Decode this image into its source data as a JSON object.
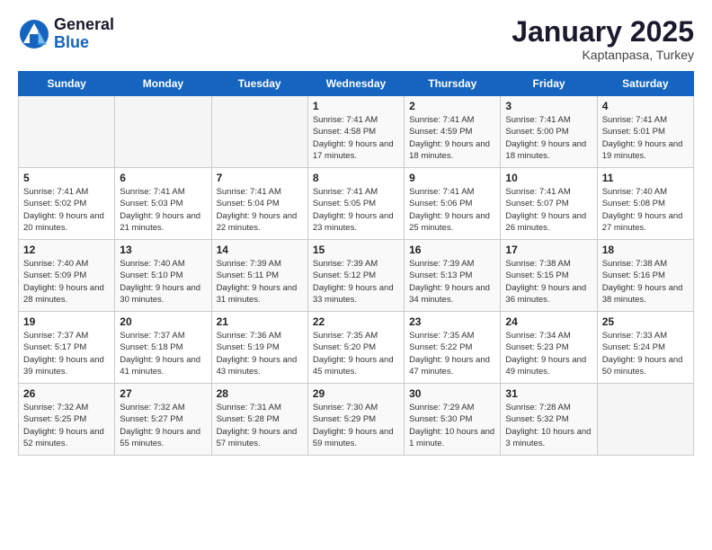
{
  "header": {
    "logo_general": "General",
    "logo_blue": "Blue",
    "month": "January 2025",
    "location": "Kaptanpasa, Turkey"
  },
  "weekdays": [
    "Sunday",
    "Monday",
    "Tuesday",
    "Wednesday",
    "Thursday",
    "Friday",
    "Saturday"
  ],
  "weeks": [
    [
      {
        "day": null
      },
      {
        "day": null
      },
      {
        "day": null
      },
      {
        "day": "1",
        "sunrise": "7:41 AM",
        "sunset": "4:58 PM",
        "daylight": "9 hours and 17 minutes."
      },
      {
        "day": "2",
        "sunrise": "7:41 AM",
        "sunset": "4:59 PM",
        "daylight": "9 hours and 18 minutes."
      },
      {
        "day": "3",
        "sunrise": "7:41 AM",
        "sunset": "5:00 PM",
        "daylight": "9 hours and 18 minutes."
      },
      {
        "day": "4",
        "sunrise": "7:41 AM",
        "sunset": "5:01 PM",
        "daylight": "9 hours and 19 minutes."
      }
    ],
    [
      {
        "day": "5",
        "sunrise": "7:41 AM",
        "sunset": "5:02 PM",
        "daylight": "9 hours and 20 minutes."
      },
      {
        "day": "6",
        "sunrise": "7:41 AM",
        "sunset": "5:03 PM",
        "daylight": "9 hours and 21 minutes."
      },
      {
        "day": "7",
        "sunrise": "7:41 AM",
        "sunset": "5:04 PM",
        "daylight": "9 hours and 22 minutes."
      },
      {
        "day": "8",
        "sunrise": "7:41 AM",
        "sunset": "5:05 PM",
        "daylight": "9 hours and 23 minutes."
      },
      {
        "day": "9",
        "sunrise": "7:41 AM",
        "sunset": "5:06 PM",
        "daylight": "9 hours and 25 minutes."
      },
      {
        "day": "10",
        "sunrise": "7:41 AM",
        "sunset": "5:07 PM",
        "daylight": "9 hours and 26 minutes."
      },
      {
        "day": "11",
        "sunrise": "7:40 AM",
        "sunset": "5:08 PM",
        "daylight": "9 hours and 27 minutes."
      }
    ],
    [
      {
        "day": "12",
        "sunrise": "7:40 AM",
        "sunset": "5:09 PM",
        "daylight": "9 hours and 28 minutes."
      },
      {
        "day": "13",
        "sunrise": "7:40 AM",
        "sunset": "5:10 PM",
        "daylight": "9 hours and 30 minutes."
      },
      {
        "day": "14",
        "sunrise": "7:39 AM",
        "sunset": "5:11 PM",
        "daylight": "9 hours and 31 minutes."
      },
      {
        "day": "15",
        "sunrise": "7:39 AM",
        "sunset": "5:12 PM",
        "daylight": "9 hours and 33 minutes."
      },
      {
        "day": "16",
        "sunrise": "7:39 AM",
        "sunset": "5:13 PM",
        "daylight": "9 hours and 34 minutes."
      },
      {
        "day": "17",
        "sunrise": "7:38 AM",
        "sunset": "5:15 PM",
        "daylight": "9 hours and 36 minutes."
      },
      {
        "day": "18",
        "sunrise": "7:38 AM",
        "sunset": "5:16 PM",
        "daylight": "9 hours and 38 minutes."
      }
    ],
    [
      {
        "day": "19",
        "sunrise": "7:37 AM",
        "sunset": "5:17 PM",
        "daylight": "9 hours and 39 minutes."
      },
      {
        "day": "20",
        "sunrise": "7:37 AM",
        "sunset": "5:18 PM",
        "daylight": "9 hours and 41 minutes."
      },
      {
        "day": "21",
        "sunrise": "7:36 AM",
        "sunset": "5:19 PM",
        "daylight": "9 hours and 43 minutes."
      },
      {
        "day": "22",
        "sunrise": "7:35 AM",
        "sunset": "5:20 PM",
        "daylight": "9 hours and 45 minutes."
      },
      {
        "day": "23",
        "sunrise": "7:35 AM",
        "sunset": "5:22 PM",
        "daylight": "9 hours and 47 minutes."
      },
      {
        "day": "24",
        "sunrise": "7:34 AM",
        "sunset": "5:23 PM",
        "daylight": "9 hours and 49 minutes."
      },
      {
        "day": "25",
        "sunrise": "7:33 AM",
        "sunset": "5:24 PM",
        "daylight": "9 hours and 50 minutes."
      }
    ],
    [
      {
        "day": "26",
        "sunrise": "7:32 AM",
        "sunset": "5:25 PM",
        "daylight": "9 hours and 52 minutes."
      },
      {
        "day": "27",
        "sunrise": "7:32 AM",
        "sunset": "5:27 PM",
        "daylight": "9 hours and 55 minutes."
      },
      {
        "day": "28",
        "sunrise": "7:31 AM",
        "sunset": "5:28 PM",
        "daylight": "9 hours and 57 minutes."
      },
      {
        "day": "29",
        "sunrise": "7:30 AM",
        "sunset": "5:29 PM",
        "daylight": "9 hours and 59 minutes."
      },
      {
        "day": "30",
        "sunrise": "7:29 AM",
        "sunset": "5:30 PM",
        "daylight": "10 hours and 1 minute."
      },
      {
        "day": "31",
        "sunrise": "7:28 AM",
        "sunset": "5:32 PM",
        "daylight": "10 hours and 3 minutes."
      },
      {
        "day": null
      }
    ]
  ]
}
